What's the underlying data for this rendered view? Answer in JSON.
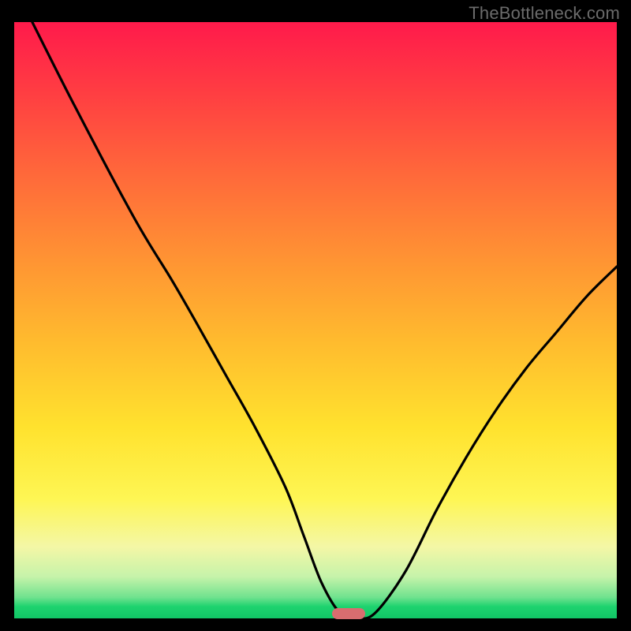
{
  "watermark": "TheBottleneck.com",
  "colors": {
    "frame": "#000000",
    "curve": "#000000",
    "marker": "#d86d6f",
    "gradient_top": "#ff1a4b",
    "gradient_bottom": "#11c566"
  },
  "chart_data": {
    "type": "line",
    "title": "",
    "xlabel": "",
    "ylabel": "",
    "xlim": [
      0,
      100
    ],
    "ylim": [
      0,
      100
    ],
    "curve": {
      "x": [
        3,
        10,
        20,
        26,
        30,
        35,
        40,
        45,
        48,
        51,
        54,
        57,
        60,
        65,
        70,
        75,
        80,
        85,
        90,
        95,
        100
      ],
      "y": [
        100,
        86,
        67,
        57,
        50,
        41,
        32,
        22,
        14,
        6,
        1,
        0,
        1,
        8,
        18,
        27,
        35,
        42,
        48,
        54,
        59
      ]
    },
    "marker": {
      "x": 55.5,
      "y": 0.5
    },
    "notes": "x in percent of plot width, y in percent of plot height (0 = bottom green band, 100 = top). Curve is a bottleneck V-shape with minimum near x≈56."
  }
}
